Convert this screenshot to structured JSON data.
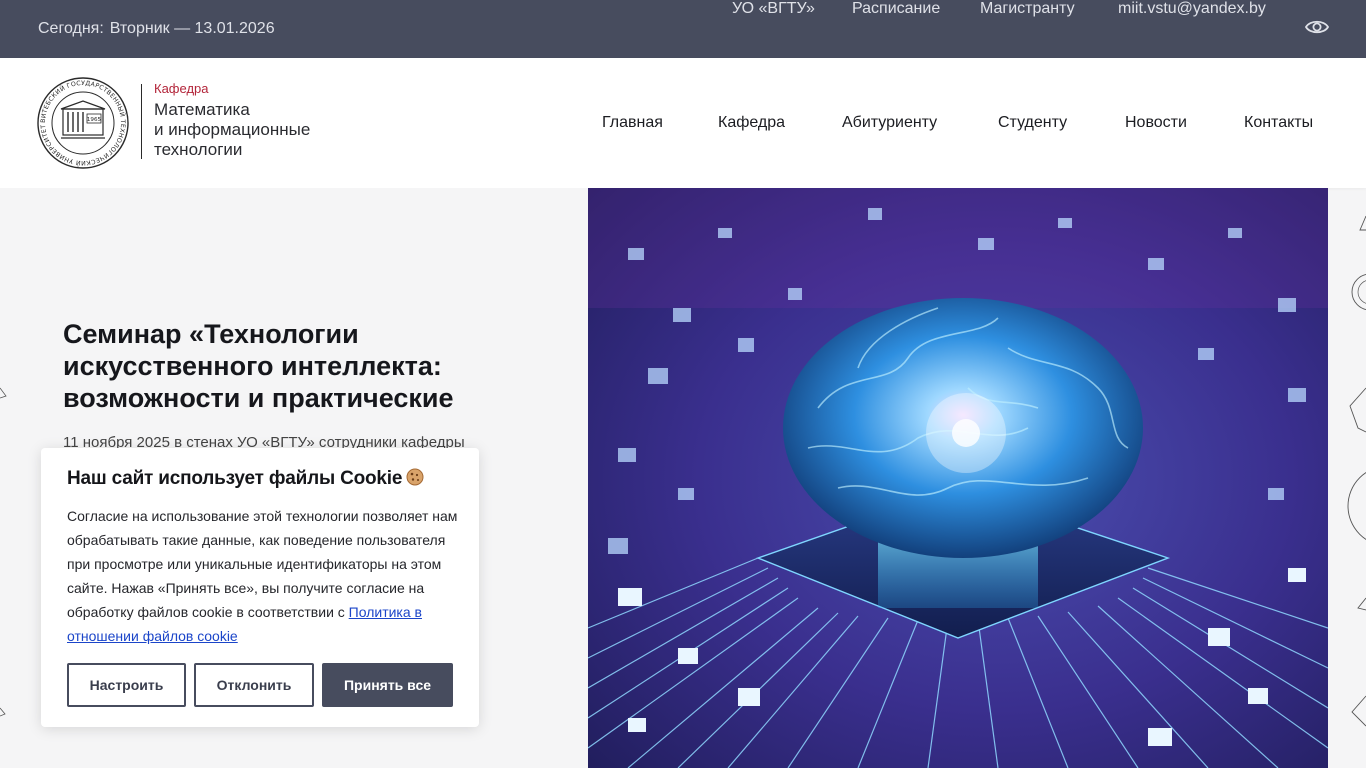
{
  "topbar": {
    "date_label": "Сегодня:",
    "date_value": "Вторник — 13.01.2026",
    "links": [
      "УО «ВГТУ»",
      "Расписание",
      "Магистранту",
      "miit.vstu@yandex.by"
    ],
    "accessibility_icon": "eye-icon"
  },
  "header": {
    "logo_ring_text": "ВИТЕБСКИЙ ГОСУДАРСТВЕННЫЙ ТЕХНОЛОГИЧЕСКИЙ УНИВЕРСИТЕТ",
    "logo_year": "1965",
    "kafedra": "Кафедра",
    "dept_line1": "Математика",
    "dept_line2": "и информационные",
    "dept_line3": "технологии",
    "nav": [
      "Главная",
      "Кафедра",
      "Абитуриенту",
      "Студенту",
      "Новости",
      "Контакты"
    ]
  },
  "hero": {
    "title": "Семинар «Технологии искусственного интеллекта: возможности и практические",
    "text": "11 ноября 2025 в стенах УО «ВГТУ» сотрудники кафедры"
  },
  "cookie": {
    "title": "Наш сайт использует файлы Cookie",
    "title_icon": "cookie-icon",
    "body": "Согласие на использование этой технологии позволяет нам обрабатывать такие данные, как поведение пользователя при просмотре или уникальные идентификаторы на этом сайте. Нажав «Принять все», вы получите согласие на обработку файлов cookie в соответствии с",
    "link": "Политика в отношении файлов cookie",
    "buttons": {
      "configure": "Настроить",
      "reject": "Отклонить",
      "accept": "Принять все"
    }
  },
  "colors": {
    "topbar": "#474c5e",
    "accent_red": "#b3253a",
    "link": "#1b45c9"
  }
}
